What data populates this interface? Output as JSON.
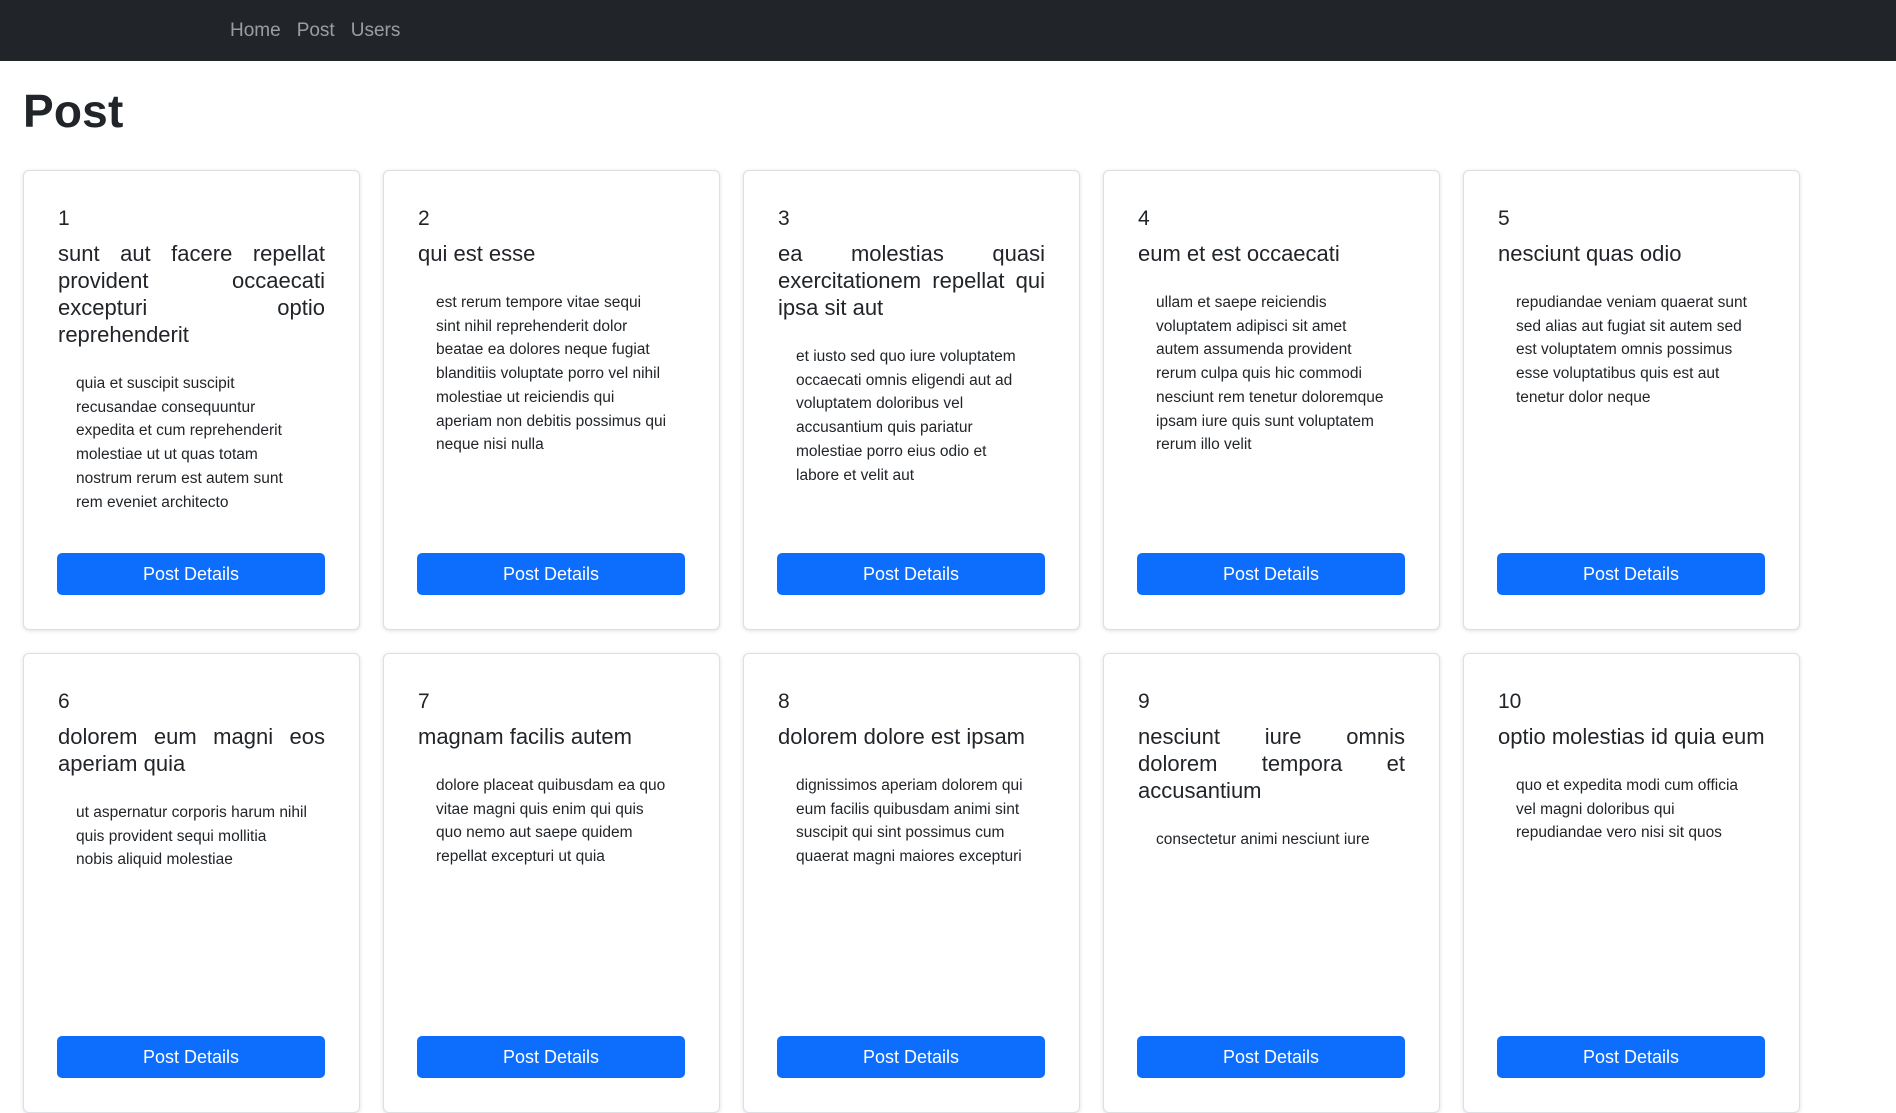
{
  "nav": {
    "links": [
      "Home",
      "Post",
      "Users"
    ]
  },
  "page": {
    "title": "Post"
  },
  "posts": [
    {
      "id": "1",
      "title": "sunt aut facere repellat provident occaecati excepturi optio reprehenderit",
      "body": "quia et suscipit suscipit recusandae consequuntur expedita et cum reprehenderit molestiae ut ut quas totam nostrum rerum est autem sunt rem eveniet architecto",
      "button": "Post Details"
    },
    {
      "id": "2",
      "title": "qui est esse",
      "body": "est rerum tempore vitae sequi sint nihil reprehenderit dolor beatae ea dolores neque fugiat blanditiis voluptate porro vel nihil molestiae ut reiciendis qui aperiam non debitis possimus qui neque nisi nulla",
      "button": "Post Details"
    },
    {
      "id": "3",
      "title": "ea molestias quasi exercitationem repellat qui ipsa sit aut",
      "body": "et iusto sed quo iure voluptatem occaecati omnis eligendi aut ad voluptatem doloribus vel accusantium quis pariatur molestiae porro eius odio et labore et velit aut",
      "button": "Post Details"
    },
    {
      "id": "4",
      "title": "eum et est occaecati",
      "body": "ullam et saepe reiciendis voluptatem adipisci sit amet autem assumenda provident rerum culpa quis hic commodi nesciunt rem tenetur doloremque ipsam iure quis sunt voluptatem rerum illo velit",
      "button": "Post Details"
    },
    {
      "id": "5",
      "title": "nesciunt quas odio",
      "body": "repudiandae veniam quaerat sunt sed alias aut fugiat sit autem sed est voluptatem omnis possimus esse voluptatibus quis est aut tenetur dolor neque",
      "button": "Post Details"
    },
    {
      "id": "6",
      "title": "dolorem eum magni eos aperiam quia",
      "body": "ut aspernatur corporis harum nihil quis provident sequi mollitia nobis aliquid molestiae",
      "button": "Post Details"
    },
    {
      "id": "7",
      "title": "magnam facilis autem",
      "body": "dolore placeat quibusdam ea quo vitae magni quis enim qui quis quo nemo aut saepe quidem repellat excepturi ut quia",
      "button": "Post Details"
    },
    {
      "id": "8",
      "title": "dolorem dolore est ipsam",
      "body": "dignissimos aperiam dolorem qui eum facilis quibusdam animi sint suscipit qui sint possimus cum quaerat magni maiores excepturi",
      "button": "Post Details"
    },
    {
      "id": "9",
      "title": "nesciunt iure omnis dolorem tempora et accusantium",
      "body": "consectetur animi nesciunt iure",
      "button": "Post Details"
    },
    {
      "id": "10",
      "title": "optio molestias id quia eum",
      "body": "quo et expedita modi cum officia vel magni doloribus qui repudiandae vero nisi sit quos",
      "button": "Post Details"
    }
  ]
}
